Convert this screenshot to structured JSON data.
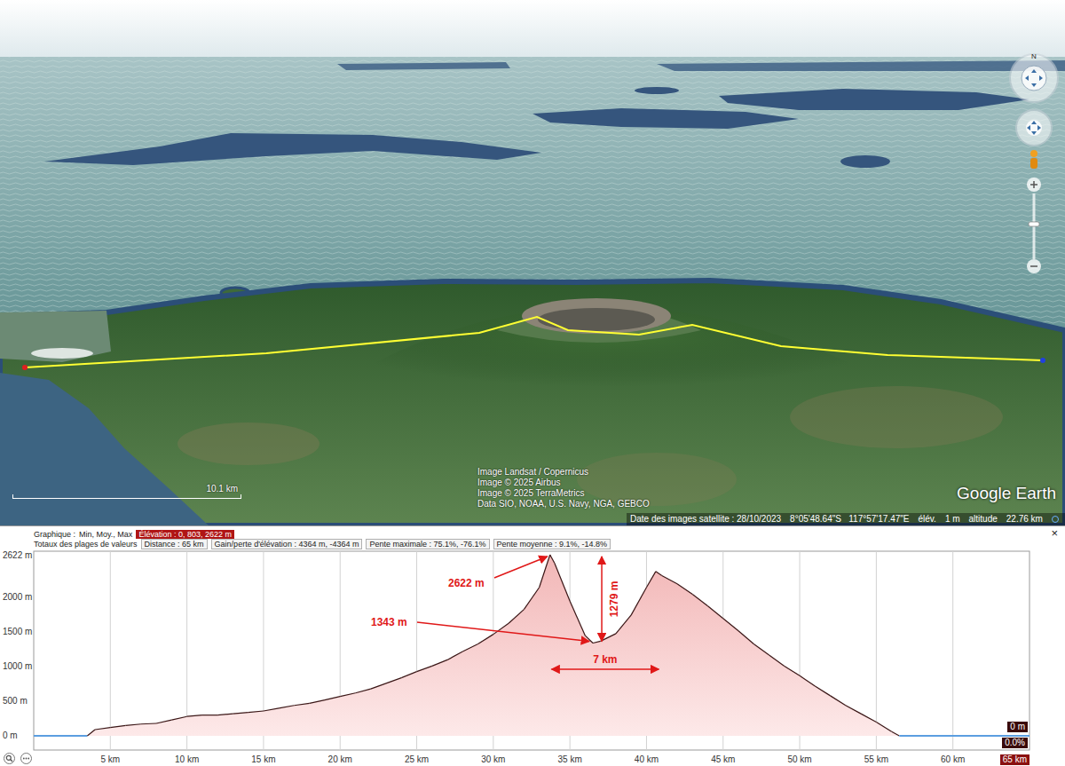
{
  "map": {
    "attribution": [
      "Image Landsat / Copernicus",
      "Image © 2025 Airbus",
      "Image © 2025 TerraMetrics",
      "Data SIO, NOAA, U.S. Navy, NGA, GEBCO"
    ],
    "logo": "Google Earth",
    "scale": "10.1 km",
    "compass": "N",
    "status": {
      "date": "Date des images satellite : 28/10/2023",
      "coords": "8°05'48.64\"S   117°57'17.47\"E",
      "elevation_label": "élév.",
      "elevation": "1 m",
      "altitude_label": "altitude",
      "altitude": "22.76 km"
    }
  },
  "profile": {
    "summary": {
      "graph": "Graphique :",
      "stats": "Min, Moy., Max",
      "elevation": "Élévation : 0, 803, 2622 m"
    },
    "totals": {
      "label": "Totaux des plages de valeurs",
      "items": [
        "Distance : 65 km",
        "Gain/perte d'élévation : 4364 m, -4364 m",
        "Pente maximale : 75.1%, -76.1%",
        "Pente moyenne : 9.1%, -14.8%"
      ]
    },
    "close": "×",
    "chart": {
      "points": [
        [
          0,
          0
        ],
        [
          3.5,
          0
        ],
        [
          4,
          90
        ],
        [
          5,
          120
        ],
        [
          6,
          150
        ],
        [
          7,
          170
        ],
        [
          8,
          180
        ],
        [
          9,
          230
        ],
        [
          10,
          280
        ],
        [
          11,
          300
        ],
        [
          12,
          300
        ],
        [
          13,
          320
        ],
        [
          14,
          340
        ],
        [
          15,
          360
        ],
        [
          16,
          400
        ],
        [
          17,
          440
        ],
        [
          18,
          470
        ],
        [
          19,
          520
        ],
        [
          20,
          570
        ],
        [
          21,
          620
        ],
        [
          22,
          680
        ],
        [
          23,
          760
        ],
        [
          24,
          840
        ],
        [
          25,
          930
        ],
        [
          26,
          1010
        ],
        [
          27,
          1100
        ],
        [
          28,
          1220
        ],
        [
          29,
          1330
        ],
        [
          30,
          1470
        ],
        [
          31,
          1630
        ],
        [
          32,
          1830
        ],
        [
          33,
          2150
        ],
        [
          33.7,
          2622
        ],
        [
          34,
          2500
        ],
        [
          35,
          1950
        ],
        [
          36,
          1450
        ],
        [
          36.5,
          1343
        ],
        [
          37,
          1370
        ],
        [
          38,
          1480
        ],
        [
          39,
          1750
        ],
        [
          40,
          2150
        ],
        [
          40.6,
          2380
        ],
        [
          41,
          2320
        ],
        [
          42,
          2200
        ],
        [
          43,
          2050
        ],
        [
          44,
          1880
        ],
        [
          45,
          1700
        ],
        [
          46,
          1520
        ],
        [
          47,
          1330
        ],
        [
          48,
          1170
        ],
        [
          49,
          1010
        ],
        [
          50,
          870
        ],
        [
          51,
          720
        ],
        [
          52,
          580
        ],
        [
          53,
          440
        ],
        [
          54,
          320
        ],
        [
          55,
          200
        ],
        [
          56,
          60
        ],
        [
          56.5,
          0
        ],
        [
          65,
          0
        ]
      ],
      "y_ticks": [
        {
          "label": "2622 m",
          "value": 2622
        },
        {
          "label": "2000 m",
          "value": 2000
        },
        {
          "label": "1500 m",
          "value": 1500
        },
        {
          "label": "1000 m",
          "value": 1000
        },
        {
          "label": "500 m",
          "value": 500
        },
        {
          "label": "0 m",
          "value": 0
        }
      ],
      "x_ticks": [
        {
          "label": "5 km",
          "value": 5
        },
        {
          "label": "10 km",
          "value": 10
        },
        {
          "label": "15 km",
          "value": 15
        },
        {
          "label": "20 km",
          "value": 20
        },
        {
          "label": "25 km",
          "value": 25
        },
        {
          "label": "30 km",
          "value": 30
        },
        {
          "label": "35 km",
          "value": 35
        },
        {
          "label": "40 km",
          "value": 40
        },
        {
          "label": "45 km",
          "value": 45
        },
        {
          "label": "50 km",
          "value": 50
        },
        {
          "label": "55 km",
          "value": 55
        },
        {
          "label": "60 km",
          "value": 60
        }
      ],
      "end_badges": {
        "elevation": "0 m",
        "slope": "0.0%",
        "distance": "65 km"
      },
      "annotations": {
        "peak": "2622 m",
        "floor": "1343 m",
        "depth": "1279 m",
        "width": "7 km"
      }
    }
  }
}
